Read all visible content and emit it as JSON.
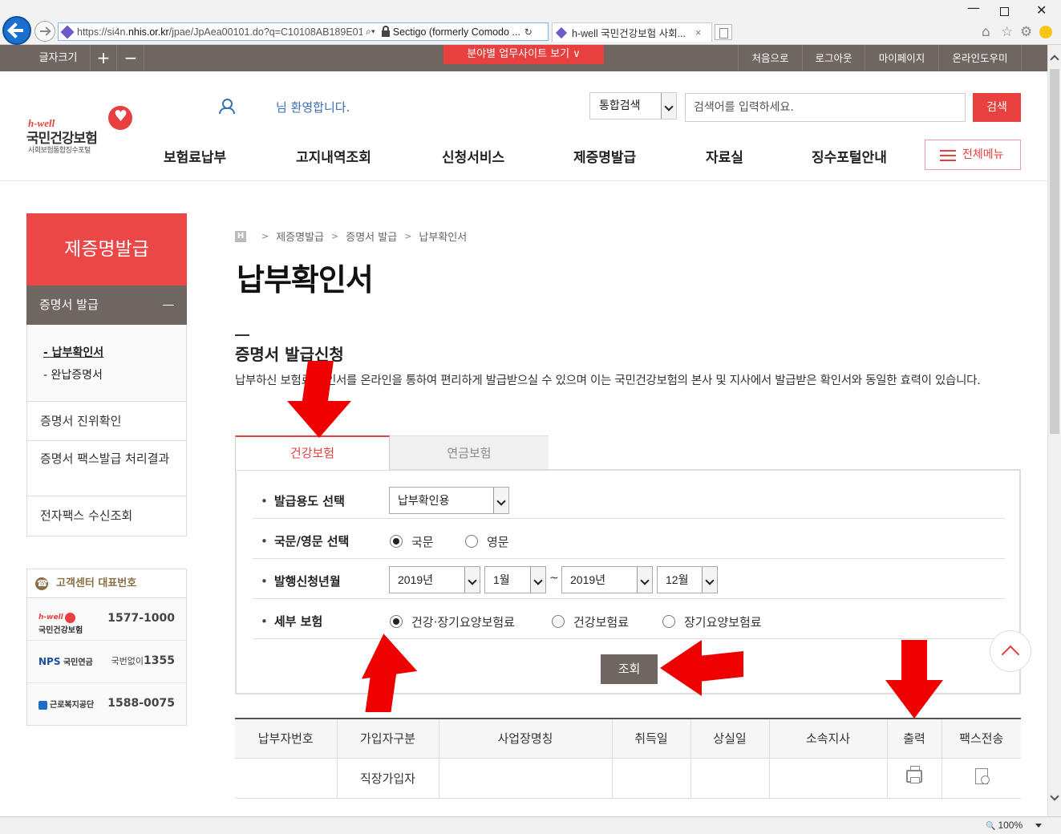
{
  "browser": {
    "url": "https://si4n.nhis.or.kr/jpae/JpAea00101.do?q=C10108AB189E01",
    "url_prefix": "https://si4n.",
    "url_domain": "nhis.or.kr",
    "url_path": "/jpae/JpAea00101.do?q=C10108AB189E01",
    "cert_label": "Sectigo (formerly Comodo ...",
    "tab_title": "h-well 국민건강보험 사회...",
    "tab_close": "×",
    "zoom": "100%"
  },
  "topbar": {
    "font_size_label": "글자크기",
    "plus": "+",
    "minus": "−",
    "site_link": "분야별 업무사이트 보기",
    "links": [
      "처음으로",
      "로그아웃",
      "마이페이지",
      "온라인도우미"
    ]
  },
  "header": {
    "logo_hwell": "h-well",
    "logo_name": "국민건강보험",
    "logo_sub": "사회보험통합징수포털",
    "welcome": "님 환영합니다.",
    "search_scope": "통합검색",
    "search_placeholder": "검색어를 입력하세요.",
    "search_button": "검색",
    "gnb": [
      "보험료납부",
      "고지내역조회",
      "신청서비스",
      "제증명발급",
      "자료실",
      "징수포털안내"
    ],
    "all_menu": "전체메뉴"
  },
  "lnb": {
    "title": "제증명발급",
    "section": "증명서 발급",
    "sub_items": [
      "- 납부확인서",
      "- 완납증명서"
    ],
    "items": [
      "증명서 진위확인",
      "증명서 팩스발급 처리결과",
      "전자팩스 수신조회"
    ]
  },
  "customer_center": {
    "title": "고객센터 대표번호",
    "rows": [
      {
        "org": "국민건강보험",
        "org_tag": "h-well",
        "number": "1577-1000",
        "prefix": ""
      },
      {
        "org": "국민연금",
        "org_tag": "NPS",
        "number": "1355",
        "prefix": "국번없이"
      },
      {
        "org": "근로복지공단",
        "org_tag": "",
        "number": "1588-0075",
        "prefix": ""
      }
    ]
  },
  "breadcrumb": {
    "home": "H",
    "items": [
      "제증명발급",
      "증명서 발급",
      "납부확인서"
    ],
    "separator": ">"
  },
  "page": {
    "title": "납부확인서",
    "section_title": "증명서 발급신청",
    "description": "납부하신 보험료 확인서를 온라인을 통하여 편리하게 발급받으실 수 있으며 이는 국민건강보험의 본사 및 지사에서 발급받은 확인서와 동일한 효력이 있습니다."
  },
  "tabs": {
    "health": "건강보험",
    "pension": "연금보험",
    "active": "health"
  },
  "form": {
    "purpose_label": "발급용도 선택",
    "purpose_value": "납부확인용",
    "language_label": "국문/영문 선택",
    "language_options": [
      "국문",
      "영문"
    ],
    "language_selected": "국문",
    "period_label": "발행신청년월",
    "year_from": "2019년",
    "month_from": "1월",
    "range_sep": "~",
    "year_to": "2019년",
    "month_to": "12월",
    "detail_label": "세부 보험",
    "detail_options": [
      "건강·장기요양보험료",
      "건강보험료",
      "장기요양보험료"
    ],
    "detail_selected": "건강·장기요양보험료",
    "query_button": "조회"
  },
  "table": {
    "headers": [
      "납부자번호",
      "가입자구분",
      "사업장명칭",
      "취득일",
      "상실일",
      "소속지사",
      "출력",
      "팩스전송"
    ],
    "rows": [
      {
        "payer_no": "",
        "member_type": "직장가입자",
        "workplace": "",
        "acquired": "",
        "lost": "",
        "branch": "",
        "print": "print-icon",
        "fax": "fax-icon"
      }
    ]
  },
  "colors": {
    "accent_red": "#e83f3f",
    "bar_gray": "#6f6661",
    "annotation_red": "#ee0000"
  },
  "annotations": [
    "arrow-to-health-tab",
    "arrow-to-detail-radio",
    "arrow-to-query-button",
    "arrow-to-print-column"
  ]
}
